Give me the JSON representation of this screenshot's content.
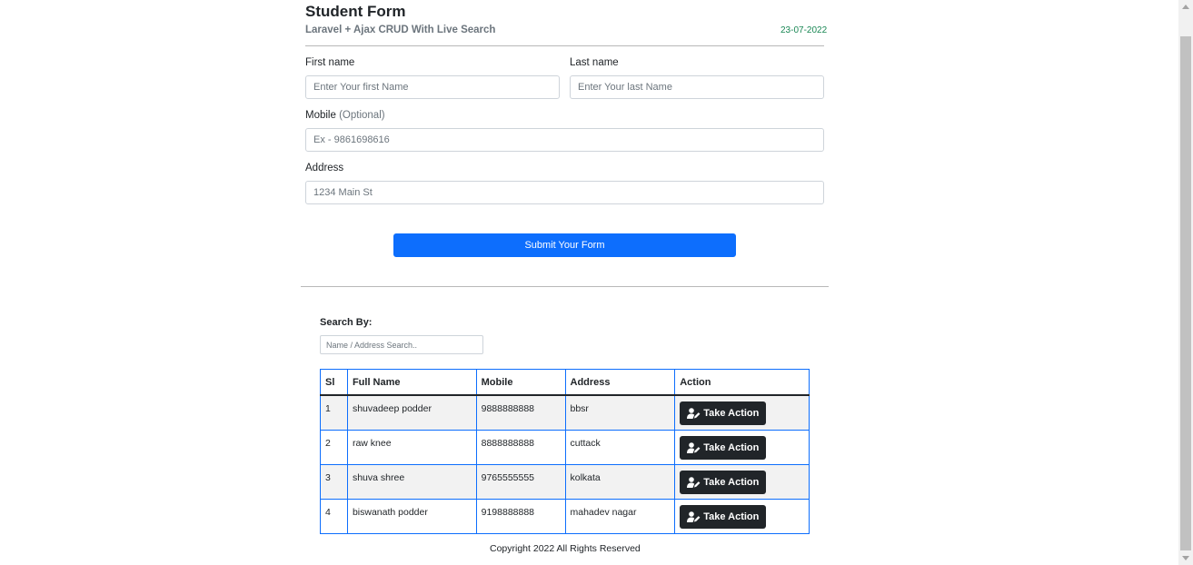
{
  "form": {
    "title": "Student Form",
    "subtitle": "Laravel + Ajax CRUD With Live Search",
    "date": "23-07-2022",
    "first_name_label": "First name",
    "first_name_placeholder": "Enter Your first Name",
    "last_name_label": "Last name",
    "last_name_placeholder": "Enter Your last Name",
    "mobile_label": "Mobile",
    "mobile_optional": "(Optional)",
    "mobile_placeholder": "Ex - 9861698616",
    "address_label": "Address",
    "address_placeholder": "1234 Main St",
    "submit_label": "Submit Your Form"
  },
  "search": {
    "label": "Search By:",
    "placeholder": "Name / Address Search.."
  },
  "table": {
    "headers": {
      "sl": "Sl",
      "full_name": "Full Name",
      "mobile": "Mobile",
      "address": "Address",
      "action": "Action"
    },
    "rows": [
      {
        "sl": "1",
        "full_name": "shuvadeep podder",
        "mobile": "9888888888",
        "address": "bbsr",
        "action": "Take Action"
      },
      {
        "sl": "2",
        "full_name": "raw knee",
        "mobile": "8888888888",
        "address": "cuttack",
        "action": "Take Action"
      },
      {
        "sl": "3",
        "full_name": "shuva shree",
        "mobile": "9765555555",
        "address": "kolkata",
        "action": "Take Action"
      },
      {
        "sl": "4",
        "full_name": "biswanath podder",
        "mobile": "9198888888",
        "address": "mahadev nagar",
        "action": "Take Action"
      }
    ]
  },
  "footer": {
    "copyright": "Copyright 2022 All Rights Reserved"
  },
  "icons": {
    "action": "user-edit-icon"
  },
  "colors": {
    "primary": "#0d6efd",
    "dark": "#212529",
    "success": "#198754",
    "muted": "#6c757d"
  }
}
